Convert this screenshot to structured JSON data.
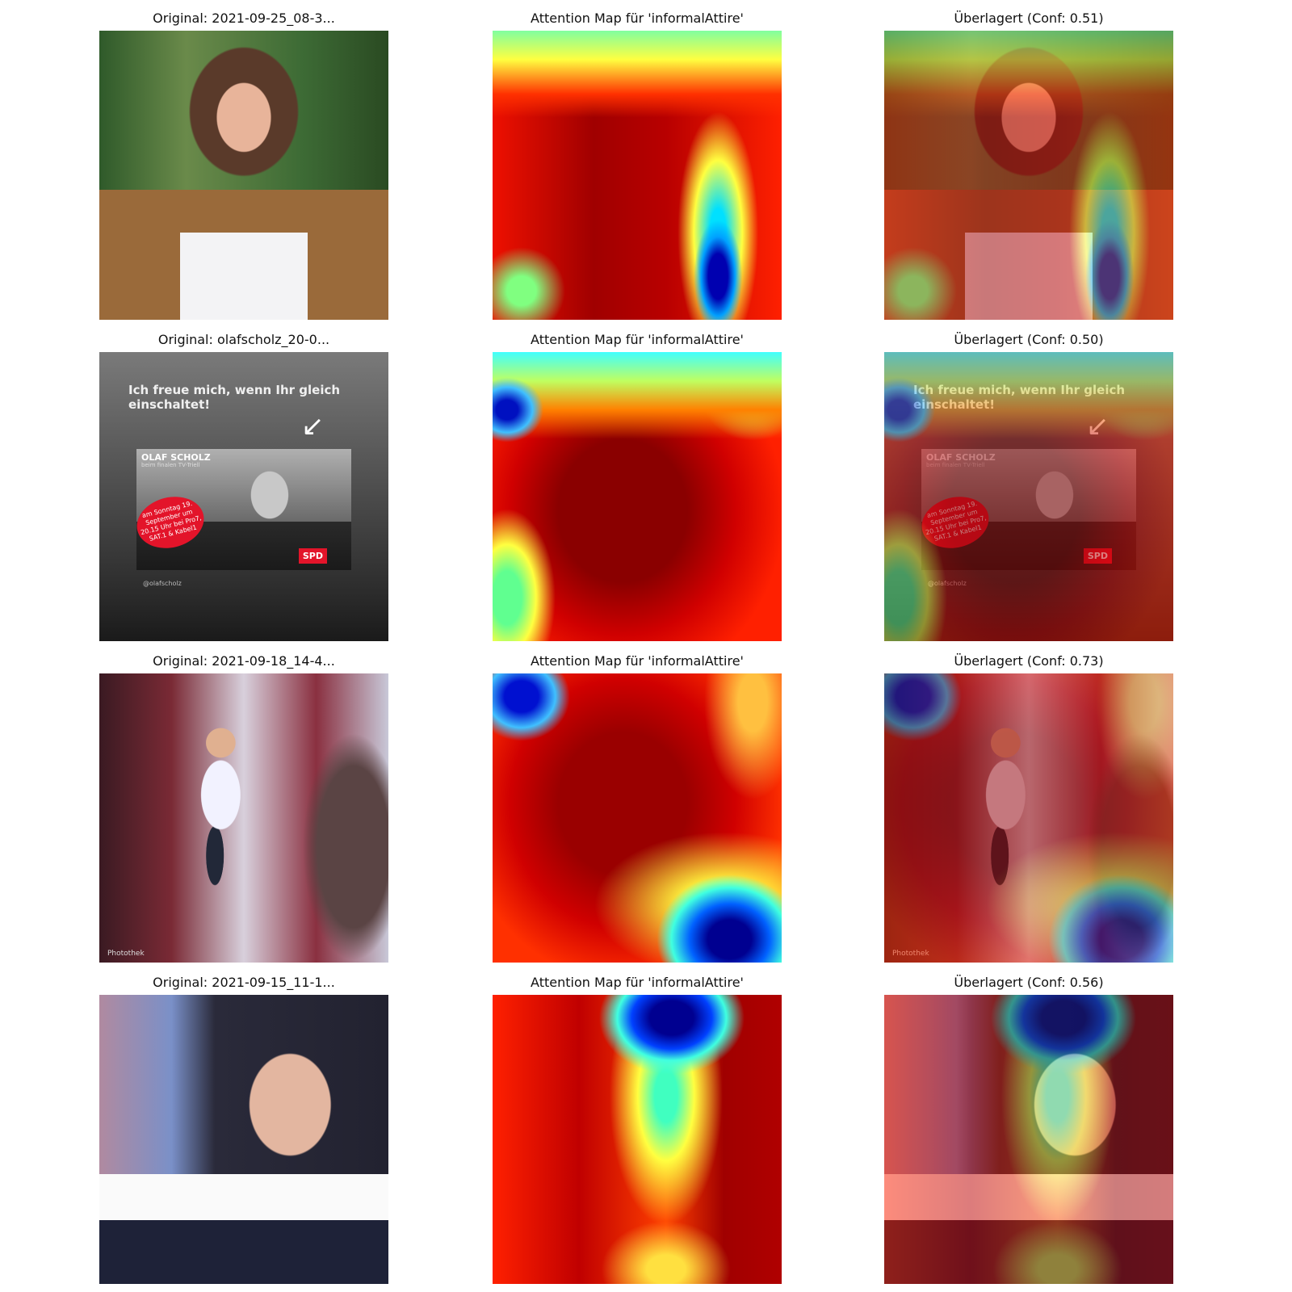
{
  "heat_label": "informalAttire",
  "rows": [
    {
      "original_title": "Original: 2021-09-25_08-3...",
      "attention_title": "Attention Map für 'informalAttire'",
      "overlay_title": "Überlagert (Conf: 0.51)",
      "confidence": 0.51
    },
    {
      "original_title": "Original: olafscholz_20-0...",
      "attention_title": "Attention Map für 'informalAttire'",
      "overlay_title": "Überlagert (Conf: 0.50)",
      "confidence": 0.5,
      "card": {
        "headline": "Ich freue mich, wenn Ihr gleich einschaltet!",
        "name": "OLAF SCHOLZ",
        "subtitle": "beim finalen TV-Triell",
        "date_text": "am Sonntag 19. September um 20.15 Uhr bei Pro7, SAT.1 & Kabel1",
        "party": "SPD",
        "handle": "@olafscholz",
        "arrow": "↙"
      }
    },
    {
      "original_title": "Original: 2021-09-18_14-4...",
      "attention_title": "Attention Map für 'informalAttire'",
      "overlay_title": "Überlagert (Conf: 0.73)",
      "confidence": 0.73,
      "watermark": "Photothek"
    },
    {
      "original_title": "Original: 2021-09-15_11-1...",
      "attention_title": "Attention Map für 'informalAttire'",
      "overlay_title": "Überlagert (Conf: 0.56)",
      "confidence": 0.56
    }
  ]
}
